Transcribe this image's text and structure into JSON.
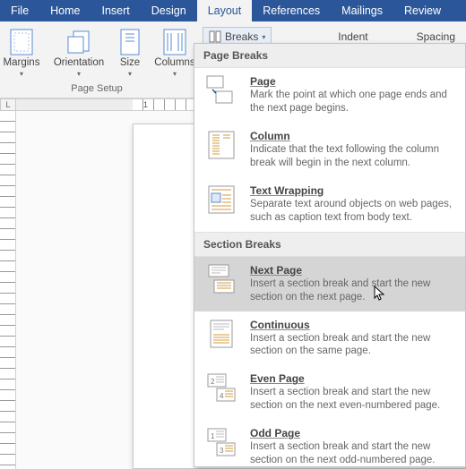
{
  "tabs": {
    "file": "File",
    "home": "Home",
    "insert": "Insert",
    "design": "Design",
    "layout": "Layout",
    "references": "References",
    "mailings": "Mailings",
    "review": "Review"
  },
  "ribbon": {
    "margins": "Margins",
    "orientation": "Orientation",
    "size": "Size",
    "columns": "Columns",
    "group_label": "Page Setup",
    "breaks_label": "Breaks",
    "indent_label": "Indent",
    "spacing_label": "Spacing"
  },
  "ruler": {
    "corner": "L",
    "one": "1"
  },
  "dropdown": {
    "section1_header": "Page Breaks",
    "section2_header": "Section Breaks",
    "items": {
      "page": {
        "title": "Page",
        "desc": "Mark the point at which one page ends and the next page begins."
      },
      "column": {
        "title": "Column",
        "desc": "Indicate that the text following the column break will begin in the next column."
      },
      "textwrap": {
        "title": "Text Wrapping",
        "desc": "Separate text around objects on web pages, such as caption text from body text."
      },
      "nextpage": {
        "title": "Next Page",
        "desc": "Insert a section break and start the new section on the next page."
      },
      "continuous": {
        "title": "Continuous",
        "desc": "Insert a section break and start the new section on the same page."
      },
      "evenpage": {
        "title": "Even Page",
        "desc": "Insert a section break and start the new section on the next even-numbered page."
      },
      "oddpage": {
        "title": "Odd Page",
        "desc": "Insert a section break and start the new section on the next odd-numbered page."
      }
    }
  }
}
